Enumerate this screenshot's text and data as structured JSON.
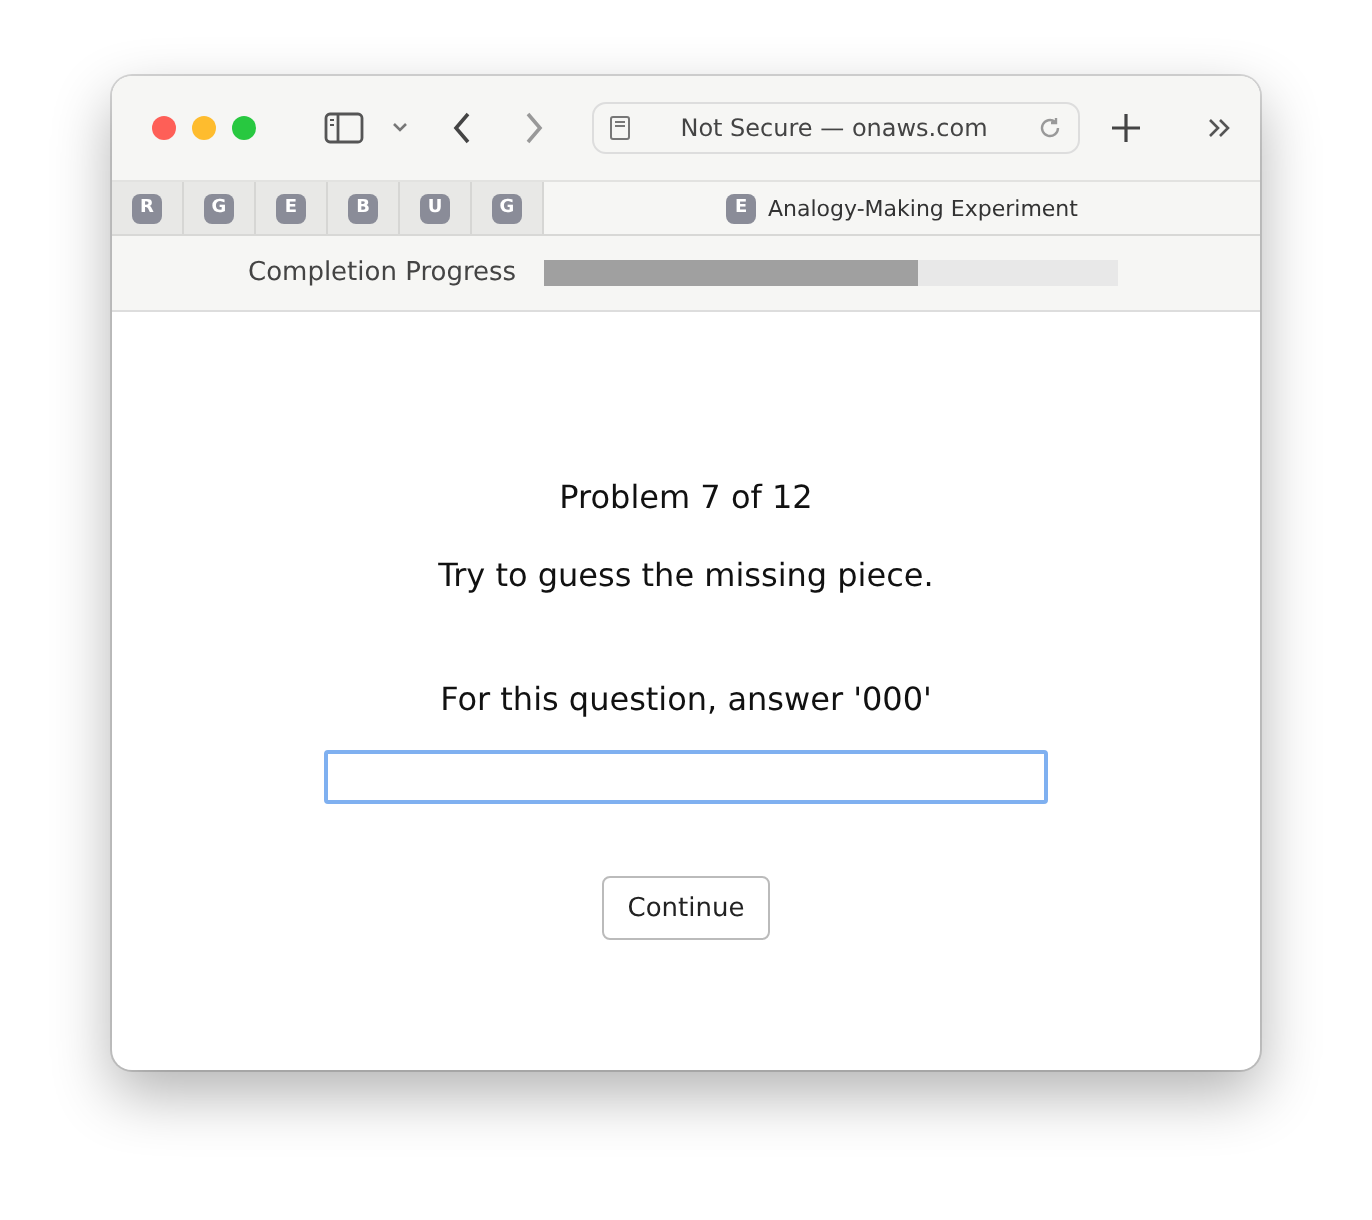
{
  "address_bar": {
    "text": "Not Secure — onaws.com"
  },
  "tabs": [
    {
      "label": "R",
      "selected": false
    },
    {
      "label": "G",
      "selected": false
    },
    {
      "label": "E",
      "selected": false
    },
    {
      "label": "B",
      "selected": false
    },
    {
      "label": "U",
      "selected": false
    },
    {
      "label": "G",
      "selected": false
    },
    {
      "label": "E",
      "title": "Analogy-Making Experiment",
      "selected": true
    }
  ],
  "progress": {
    "label": "Completion Progress",
    "level": 0.65
  },
  "heading": "Problem 7 of 12",
  "instruction": "Try to guess the missing piece.",
  "question": "For this question, answer '000'",
  "answer_field": {
    "focused": true
  },
  "continue_button": "Continue"
}
